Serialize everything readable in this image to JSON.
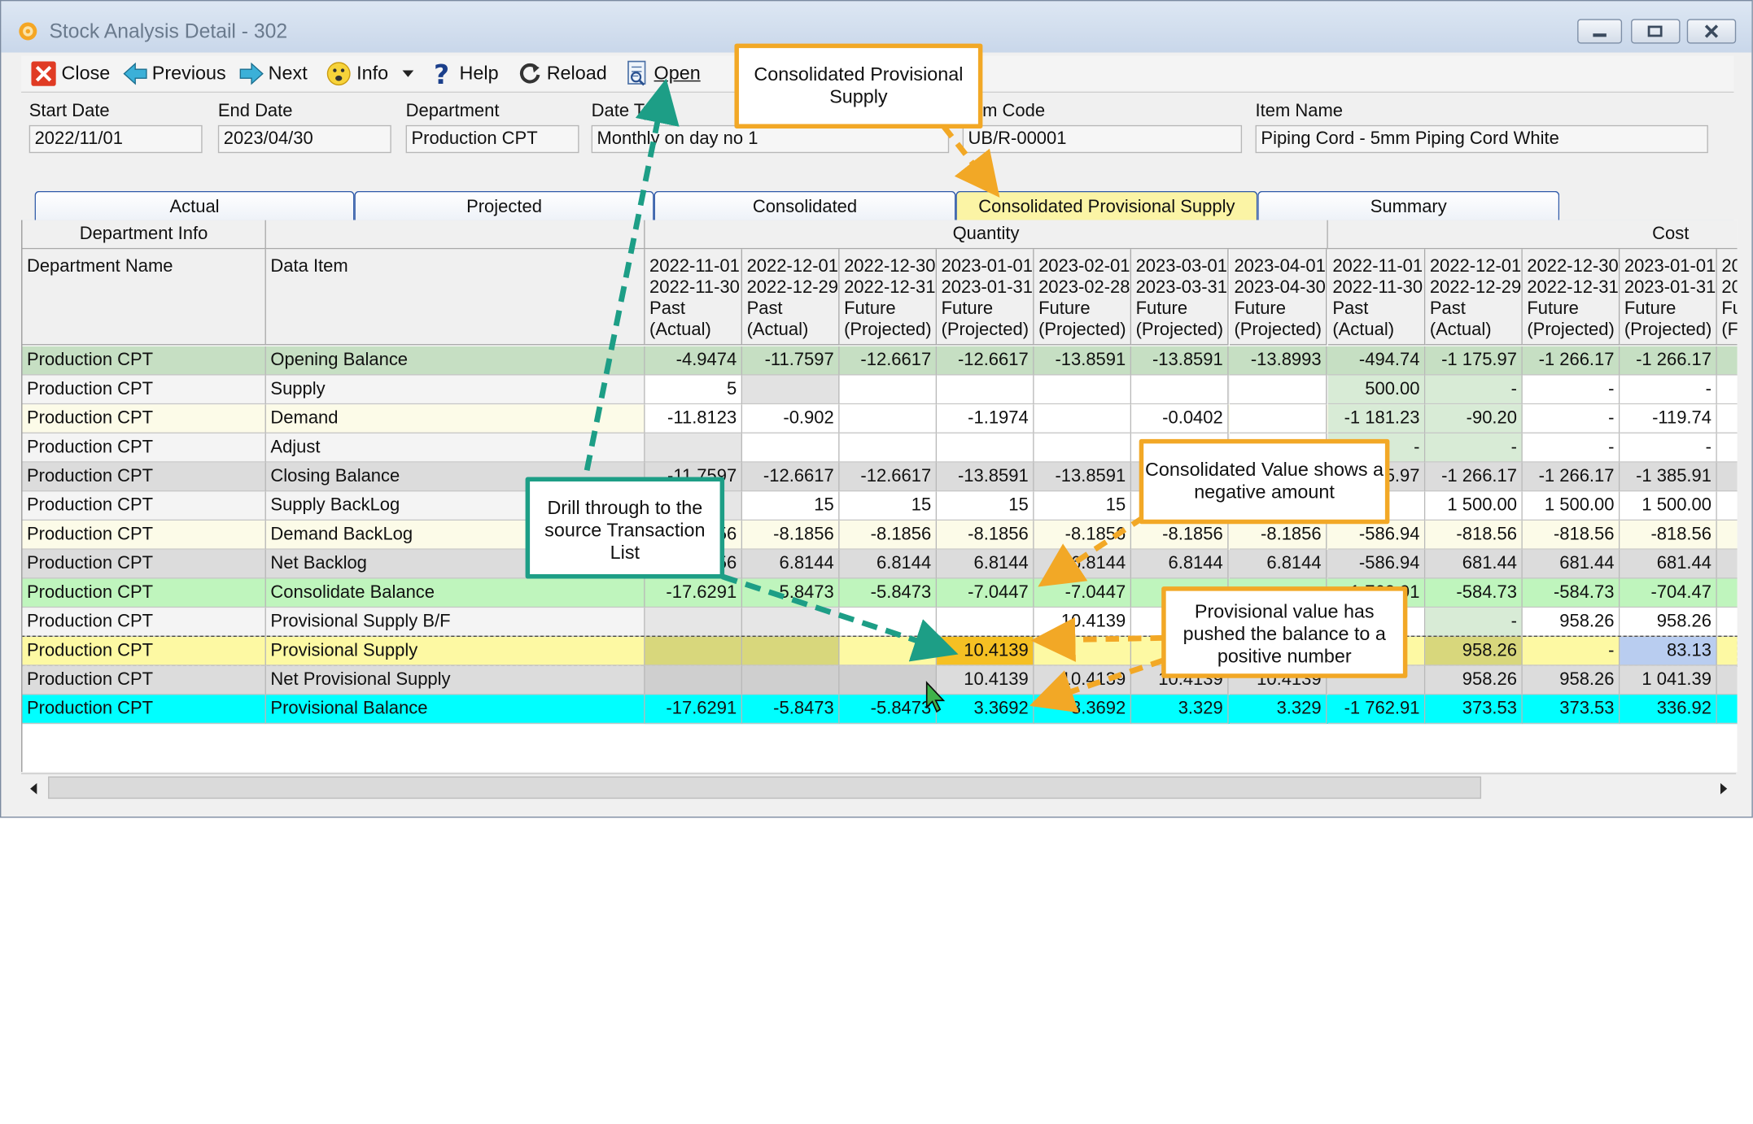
{
  "window": {
    "title": "Stock Analysis Detail - 302",
    "controls": [
      "minimize",
      "maximize",
      "close"
    ]
  },
  "toolbar": {
    "close": "Close",
    "previous": "Previous",
    "next": "Next",
    "info": "Info",
    "help": "Help",
    "reload": "Reload",
    "open": "Open"
  },
  "fields": {
    "start_date": {
      "label": "Start Date",
      "value": "2022/11/01"
    },
    "end_date": {
      "label": "End Date",
      "value": "2023/04/30"
    },
    "department": {
      "label": "Department",
      "value": "Production CPT"
    },
    "date_type": {
      "label": "Date Type",
      "value": "Monthly on day no 1"
    },
    "item_code": {
      "label": "Item Code",
      "value": "UB/R-00001"
    },
    "item_name": {
      "label": "Item Name",
      "value": "Piping Cord - 5mm Piping Cord White"
    }
  },
  "tabs": [
    "Actual",
    "Projected",
    "Consolidated",
    "Consolidated Provisional Supply",
    "Summary"
  ],
  "active_tab": "Consolidated Provisional Supply",
  "grid": {
    "group_headers": {
      "dept_info": "Department Info",
      "quantity": "Quantity",
      "cost": "Cost"
    },
    "col_dept_name": "Department Name",
    "col_data_item": "Data Item",
    "quantity_periods": [
      {
        "from": "2022-11-01",
        "to": "2022-11-30",
        "tense": "Past",
        "kind": "(Actual)"
      },
      {
        "from": "2022-12-01",
        "to": "2022-12-29",
        "tense": "Past",
        "kind": "(Actual)"
      },
      {
        "from": "2022-12-30",
        "to": "2022-12-31",
        "tense": "Future",
        "kind": "(Projected)"
      },
      {
        "from": "2023-01-01",
        "to": "2023-01-31",
        "tense": "Future",
        "kind": "(Projected)"
      },
      {
        "from": "2023-02-01",
        "to": "2023-02-28",
        "tense": "Future",
        "kind": "(Projected)"
      },
      {
        "from": "2023-03-01",
        "to": "2023-03-31",
        "tense": "Future",
        "kind": "(Projected)"
      },
      {
        "from": "2023-04-01",
        "to": "2023-04-30",
        "tense": "Future",
        "kind": "(Projected)"
      }
    ],
    "cost_periods": [
      {
        "from": "2022-11-01",
        "to": "2022-11-30",
        "tense": "Past",
        "kind": "(Actual)"
      },
      {
        "from": "2022-12-01",
        "to": "2022-12-29",
        "tense": "Past",
        "kind": "(Actual)"
      },
      {
        "from": "2022-12-30",
        "to": "2022-12-31",
        "tense": "Future",
        "kind": "(Projected)"
      },
      {
        "from": "2023-01-01",
        "to": "2023-01-31",
        "tense": "Future",
        "kind": "(Projected)"
      },
      {
        "from": "20",
        "to": "20",
        "tense": "Fu",
        "kind": "(F"
      }
    ],
    "rows": [
      {
        "dept": "Production CPT",
        "item": "Opening Balance",
        "bg": "#c6dfc3",
        "q": [
          "-4.9474",
          "-11.7597",
          "-12.6617",
          "-12.6617",
          "-13.8591",
          "-13.8591",
          "-13.8993"
        ],
        "c": [
          "-494.74",
          "-1 175.97",
          "-1 266.17",
          "-1 266.17",
          ""
        ]
      },
      {
        "dept": "Production CPT",
        "item": "Supply",
        "bg": "#f4f4f4",
        "q": [
          "5",
          "",
          "",
          "",
          "",
          "",
          ""
        ],
        "c": [
          "500.00",
          "-",
          "-",
          "-",
          ""
        ]
      },
      {
        "dept": "Production CPT",
        "item": "Demand",
        "bg": "#fcfbe8",
        "q": [
          "-11.8123",
          "-0.902",
          "",
          "-1.1974",
          "",
          "-0.0402",
          ""
        ],
        "c": [
          "-1 181.23",
          "-90.20",
          "-",
          "-119.74",
          ""
        ]
      },
      {
        "dept": "Production CPT",
        "item": "Adjust",
        "bg": "#f4f4f4",
        "q": [
          "",
          "",
          "",
          "",
          "",
          "",
          ""
        ],
        "c": [
          "-",
          "-",
          "-",
          "-",
          ""
        ]
      },
      {
        "dept": "Production CPT",
        "item": "Closing Balance",
        "bg": "#dcdcdc",
        "q": [
          "-11.7597",
          "-12.6617",
          "-12.6617",
          "-13.8591",
          "-13.8591",
          "",
          ""
        ],
        "c": [
          "-1 175.97",
          "-1 266.17",
          "-1 266.17",
          "-1 385.91",
          ""
        ]
      },
      {
        "dept": "Production CPT",
        "item": "Supply BackLog",
        "bg": "#f4f4f4",
        "q": [
          "",
          "15",
          "15",
          "15",
          "15",
          "",
          ""
        ],
        "c": [
          "",
          "1 500.00",
          "1 500.00",
          "1 500.00",
          ""
        ]
      },
      {
        "dept": "Production CPT",
        "item": "Demand BackLog",
        "bg": "#fcfbe8",
        "q": [
          "-8.1856",
          "-8.1856",
          "-8.1856",
          "-8.1856",
          "-8.1856",
          "-8.1856",
          "-8.1856"
        ],
        "c": [
          "-586.94",
          "-818.56",
          "-818.56",
          "-818.56",
          ""
        ]
      },
      {
        "dept": "Production CPT",
        "item": "Net Backlog",
        "bg": "#dcdcdc",
        "q": [
          "-8.1856",
          "6.8144",
          "6.8144",
          "6.8144",
          "6.8144",
          "6.8144",
          "6.8144"
        ],
        "c": [
          "-586.94",
          "681.44",
          "681.44",
          "681.44",
          ""
        ]
      },
      {
        "dept": "Production CPT",
        "item": "Consolidate Balance",
        "bg": "#bff5bd",
        "q": [
          "-17.6291",
          "-5.8473",
          "-5.8473",
          "-7.0447",
          "-7.0447",
          "",
          ""
        ],
        "c": [
          "-1 762.91",
          "-584.73",
          "-584.73",
          "-704.47",
          ""
        ]
      },
      {
        "dept": "Production CPT",
        "item": "Provisional Supply B/F",
        "bg": "#f4f4f4",
        "q": [
          "",
          "",
          "",
          "",
          "10.4139",
          "",
          ""
        ],
        "c": [
          "",
          "-",
          "958.26",
          "958.26",
          ""
        ]
      },
      {
        "dept": "Production CPT",
        "item": "Provisional Supply",
        "bg": "#fdf9a3",
        "q": [
          "",
          "",
          "",
          "10.4139",
          "",
          "",
          ""
        ],
        "c": [
          "",
          "958.26",
          "-",
          "83.13",
          ""
        ]
      },
      {
        "dept": "Production CPT",
        "item": "Net Provisional Supply",
        "bg": "#dcdcdc",
        "q": [
          "",
          "",
          "",
          "10.4139",
          "10.4139",
          "10.4139",
          "10.4139"
        ],
        "c": [
          "",
          "958.26",
          "958.26",
          "1 041.39",
          ""
        ]
      },
      {
        "dept": "Production CPT",
        "item": "Provisional Balance",
        "bg": "#00ffff",
        "q": [
          "-17.6291",
          "-5.8473",
          "-5.8473",
          "3.3692",
          "3.3692",
          "3.329",
          "3.329"
        ],
        "c": [
          "-1 762.91",
          "373.53",
          "373.53",
          "336.92",
          ""
        ]
      }
    ]
  },
  "callouts": {
    "consolidated_provisional_supply": "Consolidated Provisional Supply",
    "negative_amount": "Consolidated Value shows a negative amount",
    "drill_through": "Drill through to the source Transaction List",
    "provisional_positive": "Provisional value has pushed the balance to a positive number"
  },
  "colors": {
    "orange": "#f2a826",
    "teal": "#1d9e86",
    "tab_border": "#2e59a8",
    "active_tab": "#fbf4a5"
  }
}
